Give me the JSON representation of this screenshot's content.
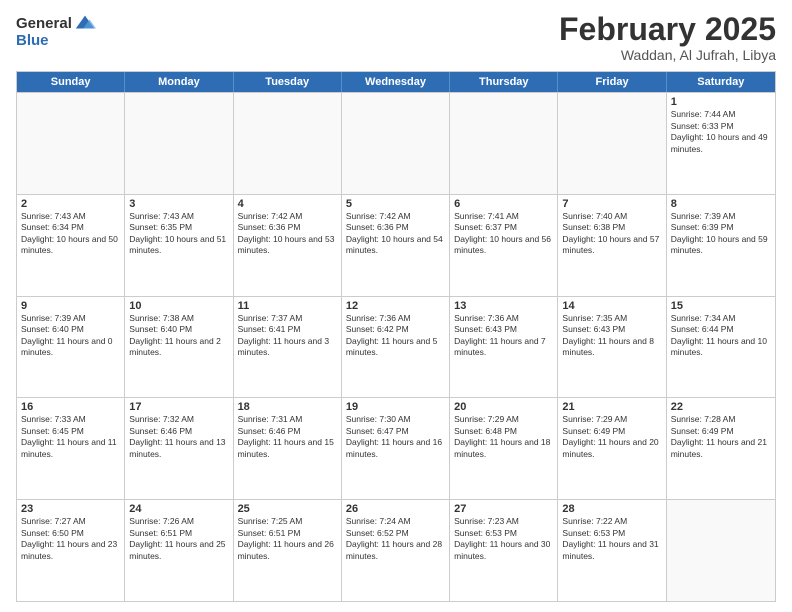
{
  "header": {
    "logo": {
      "line1": "General",
      "line2": "Blue"
    },
    "title": "February 2025",
    "subtitle": "Waddan, Al Jufrah, Libya"
  },
  "days_of_week": [
    "Sunday",
    "Monday",
    "Tuesday",
    "Wednesday",
    "Thursday",
    "Friday",
    "Saturday"
  ],
  "weeks": [
    [
      {
        "day": "",
        "empty": true
      },
      {
        "day": "",
        "empty": true
      },
      {
        "day": "",
        "empty": true
      },
      {
        "day": "",
        "empty": true
      },
      {
        "day": "",
        "empty": true
      },
      {
        "day": "",
        "empty": true
      },
      {
        "day": "1",
        "sunrise": "7:44 AM",
        "sunset": "6:33 PM",
        "daylight": "10 hours and 49 minutes."
      }
    ],
    [
      {
        "day": "2",
        "sunrise": "7:43 AM",
        "sunset": "6:34 PM",
        "daylight": "10 hours and 50 minutes."
      },
      {
        "day": "3",
        "sunrise": "7:43 AM",
        "sunset": "6:35 PM",
        "daylight": "10 hours and 51 minutes."
      },
      {
        "day": "4",
        "sunrise": "7:42 AM",
        "sunset": "6:36 PM",
        "daylight": "10 hours and 53 minutes."
      },
      {
        "day": "5",
        "sunrise": "7:42 AM",
        "sunset": "6:36 PM",
        "daylight": "10 hours and 54 minutes."
      },
      {
        "day": "6",
        "sunrise": "7:41 AM",
        "sunset": "6:37 PM",
        "daylight": "10 hours and 56 minutes."
      },
      {
        "day": "7",
        "sunrise": "7:40 AM",
        "sunset": "6:38 PM",
        "daylight": "10 hours and 57 minutes."
      },
      {
        "day": "8",
        "sunrise": "7:39 AM",
        "sunset": "6:39 PM",
        "daylight": "10 hours and 59 minutes."
      }
    ],
    [
      {
        "day": "9",
        "sunrise": "7:39 AM",
        "sunset": "6:40 PM",
        "daylight": "11 hours and 0 minutes."
      },
      {
        "day": "10",
        "sunrise": "7:38 AM",
        "sunset": "6:40 PM",
        "daylight": "11 hours and 2 minutes."
      },
      {
        "day": "11",
        "sunrise": "7:37 AM",
        "sunset": "6:41 PM",
        "daylight": "11 hours and 3 minutes."
      },
      {
        "day": "12",
        "sunrise": "7:36 AM",
        "sunset": "6:42 PM",
        "daylight": "11 hours and 5 minutes."
      },
      {
        "day": "13",
        "sunrise": "7:36 AM",
        "sunset": "6:43 PM",
        "daylight": "11 hours and 7 minutes."
      },
      {
        "day": "14",
        "sunrise": "7:35 AM",
        "sunset": "6:43 PM",
        "daylight": "11 hours and 8 minutes."
      },
      {
        "day": "15",
        "sunrise": "7:34 AM",
        "sunset": "6:44 PM",
        "daylight": "11 hours and 10 minutes."
      }
    ],
    [
      {
        "day": "16",
        "sunrise": "7:33 AM",
        "sunset": "6:45 PM",
        "daylight": "11 hours and 11 minutes."
      },
      {
        "day": "17",
        "sunrise": "7:32 AM",
        "sunset": "6:46 PM",
        "daylight": "11 hours and 13 minutes."
      },
      {
        "day": "18",
        "sunrise": "7:31 AM",
        "sunset": "6:46 PM",
        "daylight": "11 hours and 15 minutes."
      },
      {
        "day": "19",
        "sunrise": "7:30 AM",
        "sunset": "6:47 PM",
        "daylight": "11 hours and 16 minutes."
      },
      {
        "day": "20",
        "sunrise": "7:29 AM",
        "sunset": "6:48 PM",
        "daylight": "11 hours and 18 minutes."
      },
      {
        "day": "21",
        "sunrise": "7:29 AM",
        "sunset": "6:49 PM",
        "daylight": "11 hours and 20 minutes."
      },
      {
        "day": "22",
        "sunrise": "7:28 AM",
        "sunset": "6:49 PM",
        "daylight": "11 hours and 21 minutes."
      }
    ],
    [
      {
        "day": "23",
        "sunrise": "7:27 AM",
        "sunset": "6:50 PM",
        "daylight": "11 hours and 23 minutes."
      },
      {
        "day": "24",
        "sunrise": "7:26 AM",
        "sunset": "6:51 PM",
        "daylight": "11 hours and 25 minutes."
      },
      {
        "day": "25",
        "sunrise": "7:25 AM",
        "sunset": "6:51 PM",
        "daylight": "11 hours and 26 minutes."
      },
      {
        "day": "26",
        "sunrise": "7:24 AM",
        "sunset": "6:52 PM",
        "daylight": "11 hours and 28 minutes."
      },
      {
        "day": "27",
        "sunrise": "7:23 AM",
        "sunset": "6:53 PM",
        "daylight": "11 hours and 30 minutes."
      },
      {
        "day": "28",
        "sunrise": "7:22 AM",
        "sunset": "6:53 PM",
        "daylight": "11 hours and 31 minutes."
      },
      {
        "day": "",
        "empty": true
      }
    ]
  ]
}
